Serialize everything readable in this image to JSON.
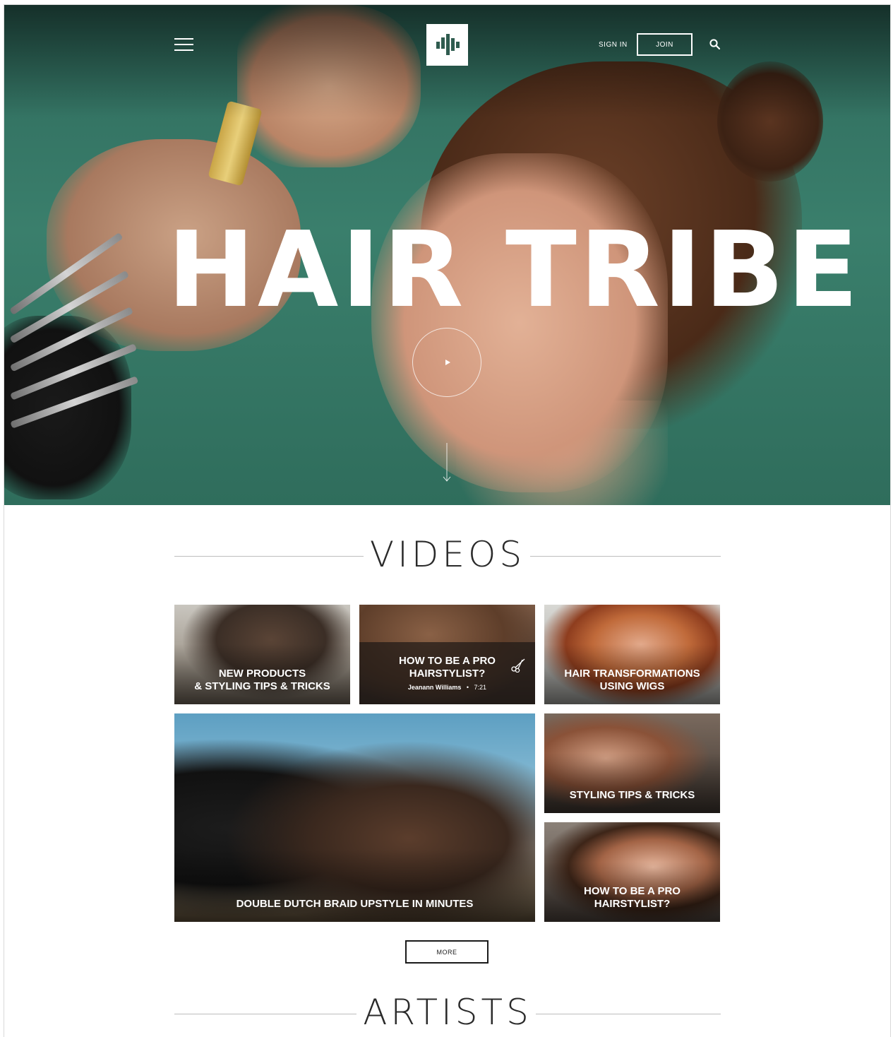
{
  "header": {
    "sign_in_label": "SIGN IN",
    "join_label": "JOIN",
    "menu_icon": "hamburger-icon",
    "search_icon": "search-icon",
    "logo_icon": "hair-tribe-logo"
  },
  "hero": {
    "title": "HAIR TRIBE",
    "play_icon": "play-icon",
    "scroll_icon": "arrow-down-icon"
  },
  "videos": {
    "heading": "VIDEOS",
    "tiles": [
      {
        "title_line1": "NEW PRODUCTS",
        "title_line2": "& STYLING TIPS & TRICKS"
      },
      {
        "title_line1": "HOW TO BE A PRO",
        "title_line2": "HAIRSTYLIST?",
        "author": "Jeanann Williams",
        "duration": "7:21",
        "icon": "scissors-icon"
      },
      {
        "title_line1": "HAIR TRANSFORMATIONS",
        "title_line2": "USING WIGS"
      },
      {
        "title_line1": "DOUBLE DUTCH BRAID UPSTYLE IN MINUTES"
      },
      {
        "title_line1": "STYLING TIPS & TRICKS"
      },
      {
        "title_line1": "HOW TO BE A PRO",
        "title_line2": "HAIRSTYLIST?"
      }
    ],
    "more_label": "MORE"
  },
  "artists": {
    "heading": "ARTISTS"
  },
  "colors": {
    "hero_green": "#3a7f6c",
    "logo_green": "#2f5c4f",
    "text_dark": "#2a2a2a",
    "rule_gray": "#bdbdbd"
  }
}
